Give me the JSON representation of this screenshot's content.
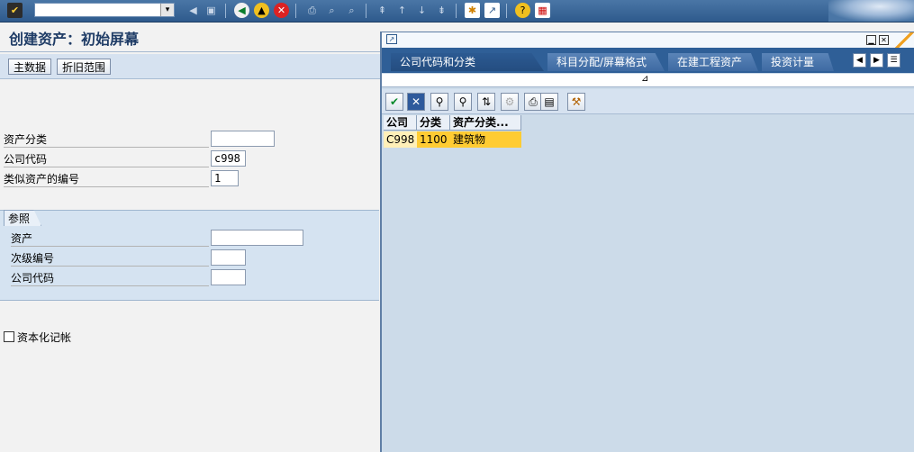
{
  "window": {
    "title": "创建资产：初始屏幕"
  },
  "system_toolbar": {
    "command_placeholder": ""
  },
  "app_toolbar": {
    "master_data_label": "主数据",
    "depreciation_areas_label": "折旧范围"
  },
  "form": {
    "asset_class": {
      "label": "资产分类",
      "value": ""
    },
    "company_code": {
      "label": "公司代码",
      "value": "c998"
    },
    "similar_assets": {
      "label": "类似资产的编号",
      "value": "1"
    }
  },
  "reference": {
    "tab_label": "参照",
    "asset": {
      "label": "资产",
      "value": ""
    },
    "sub_number": {
      "label": "次级编号",
      "value": ""
    },
    "company_code": {
      "label": "公司代码",
      "value": ""
    }
  },
  "capitalization": {
    "label": "资本化记帐",
    "checked": false
  },
  "popup": {
    "tabs": [
      {
        "label": "公司代码和分类",
        "active": true
      },
      {
        "label": "科目分配/屏幕格式",
        "active": false
      },
      {
        "label": "在建工程资产",
        "active": false
      },
      {
        "label": "投资计量",
        "active": false
      }
    ],
    "columns": [
      "公司",
      "分类",
      "资产分类..."
    ],
    "rows": [
      {
        "company": "C998",
        "class": "1100",
        "description": "建筑物"
      }
    ]
  },
  "colors": {
    "toolbar": "#2e5a8c",
    "selection": "#ffcc33",
    "tab_active": "#244d80"
  }
}
